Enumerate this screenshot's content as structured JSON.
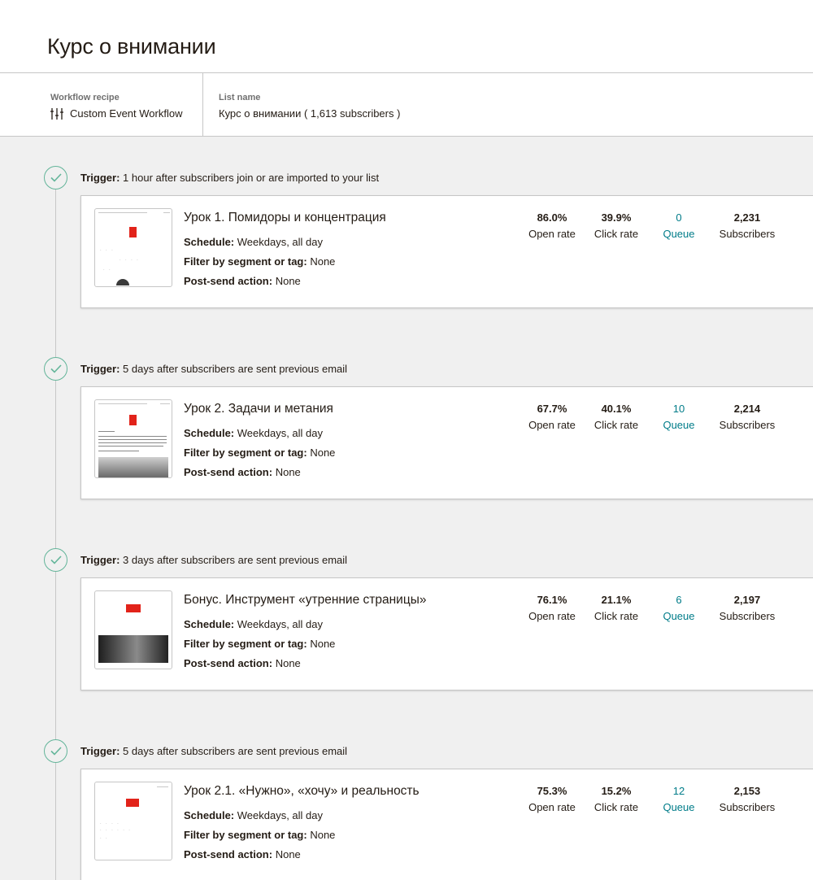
{
  "page": {
    "title": "Курс о внимании"
  },
  "info": {
    "recipe_label": "Workflow recipe",
    "recipe_value": "Custom Event Workflow",
    "recipe_icon": "sliders-icon",
    "list_label": "List name",
    "list_value": "Курс о внимании ( 1,613 subscribers )"
  },
  "labels": {
    "trigger": "Trigger:",
    "schedule": "Schedule:",
    "filter": "Filter by segment or tag:",
    "post_send": "Post-send action:",
    "open_rate": "Open rate",
    "click_rate": "Click rate",
    "queue": "Queue",
    "subscribers": "Subscribers"
  },
  "colors": {
    "accent": "#007c89",
    "check": "#64b59a",
    "brand_red": "#e2231a"
  },
  "emails": [
    {
      "trigger": "1 hour after subscribers join or are imported to your list",
      "title": "Урок 1. Помидоры и концентрация",
      "schedule": "Weekdays, all day",
      "filter": "None",
      "post_send": "None",
      "open_rate": "86.0%",
      "click_rate": "39.9%",
      "queue": "0",
      "subscribers": "2,231"
    },
    {
      "trigger": "5 days after subscribers are sent previous email",
      "title": "Урок 2. Задачи и метания",
      "schedule": "Weekdays, all day",
      "filter": "None",
      "post_send": "None",
      "open_rate": "67.7%",
      "click_rate": "40.1%",
      "queue": "10",
      "subscribers": "2,214"
    },
    {
      "trigger": "3 days after subscribers are sent previous email",
      "title": "Бонус. Инструмент «утренние страницы»",
      "schedule": "Weekdays, all day",
      "filter": "None",
      "post_send": "None",
      "open_rate": "76.1%",
      "click_rate": "21.1%",
      "queue": "6",
      "subscribers": "2,197"
    },
    {
      "trigger": "5 days after subscribers are sent previous email",
      "title": "Урок 2.1. «Нужно», «хочу» и реальность",
      "schedule": "Weekdays, all day",
      "filter": "None",
      "post_send": "None",
      "open_rate": "75.3%",
      "click_rate": "15.2%",
      "queue": "12",
      "subscribers": "2,153"
    }
  ]
}
